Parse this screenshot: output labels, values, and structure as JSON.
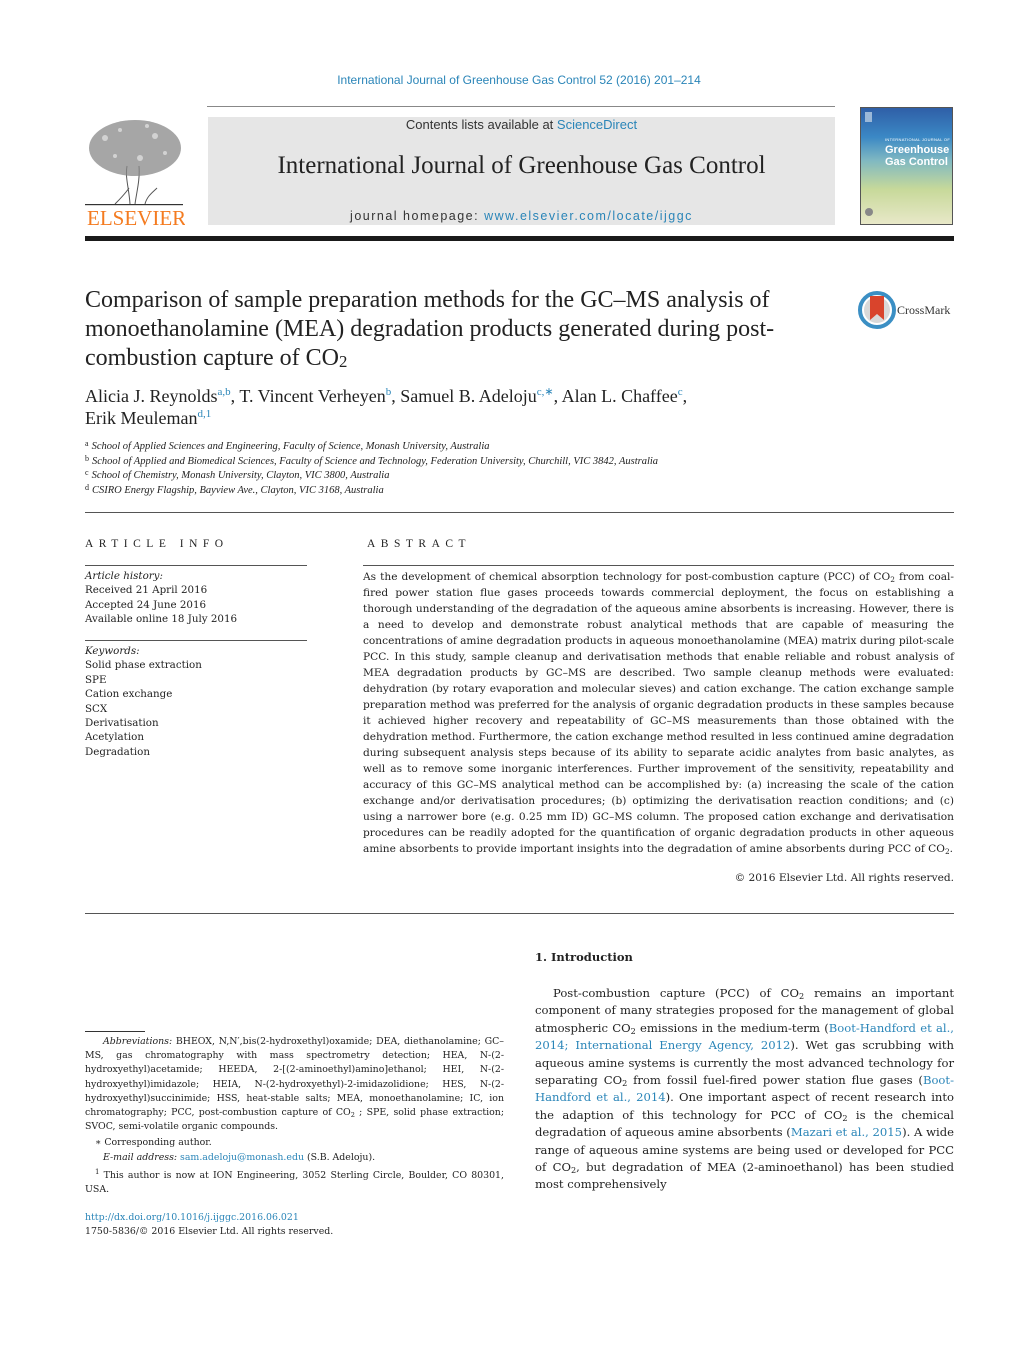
{
  "header": {
    "journal_citation": "International Journal of Greenhouse Gas Control 52 (2016) 201–214",
    "contents_prefix": "Contents lists available at ",
    "contents_link": "ScienceDirect",
    "journal_name": "International Journal of Greenhouse Gas Control",
    "homepage_prefix": "journal homepage: ",
    "homepage_link": "www.elsevier.com/locate/ijggc",
    "publisher_logo_text": "ELSEVIER",
    "cover_small_text": "INTERNATIONAL JOURNAL OF",
    "cover_title_line1": "Greenhouse",
    "cover_title_line2": "Gas Control"
  },
  "article": {
    "title_main": "Comparison of sample preparation methods for the GC–MS analysis of monoethanolamine (MEA) degradation products generated during post-combustion capture of CO",
    "title_sub": "2",
    "crossmark_label": "CrossMark",
    "authors": [
      {
        "name": "Alicia J. Reynolds",
        "sup": "a,b",
        "sep": ", "
      },
      {
        "name": "T. Vincent Verheyen",
        "sup": "b",
        "sep": ", "
      },
      {
        "name": "Samuel B. Adeloju",
        "sup": "c,∗",
        "sep": ", "
      },
      {
        "name": "Alan L. Chaffee",
        "sup": "c",
        "sep": ","
      },
      {
        "name": "Erik Meuleman",
        "sup": "d,1",
        "sep": ""
      }
    ],
    "affiliations": [
      {
        "key": "a",
        "text": "School of Applied Sciences and Engineering, Faculty of Science, Monash University, Australia"
      },
      {
        "key": "b",
        "text": "School of Applied and Biomedical Sciences, Faculty of Science and Technology, Federation University, Churchill, VIC 3842, Australia"
      },
      {
        "key": "c",
        "text": "School of Chemistry, Monash University, Clayton, VIC 3800, Australia"
      },
      {
        "key": "d",
        "text": "CSIRO Energy Flagship, Bayview Ave., Clayton, VIC 3168, Australia"
      }
    ]
  },
  "article_info": {
    "heading": "ARTICLE INFO",
    "history_label": "Article history:",
    "history": [
      "Received 21 April 2016",
      "Accepted 24 June 2016",
      "Available online 18 July 2016"
    ],
    "keywords_label": "Keywords:",
    "keywords": [
      "Solid phase extraction",
      "SPE",
      "Cation exchange",
      "SCX",
      "Derivatisation",
      "Acetylation",
      "Degradation"
    ]
  },
  "abstract": {
    "heading": "ABSTRACT",
    "part1": "As the development of chemical absorption technology for post-combustion capture (PCC) of CO",
    "part2": " from coal-fired power station flue gases proceeds towards commercial deployment, the focus on establishing a thorough understanding of the degradation of the aqueous amine absorbents is increasing. However, there is a need to develop and demonstrate robust analytical methods that are capable of measuring the concentrations of amine degradation products in aqueous monoethanolamine (MEA) matrix during pilot-scale PCC. In this study, sample cleanup and derivatisation methods that enable reliable and robust analysis of MEA degradation products by GC–MS are described. Two sample cleanup methods were evaluated: dehydration (by rotary evaporation and molecular sieves) and cation exchange. The cation exchange sample preparation method was preferred for the analysis of organic degradation products in these samples because it achieved higher recovery and repeatability of GC–MS measurements than those obtained with the dehydration method. Furthermore, the cation exchange method resulted in less continued amine degradation during subsequent analysis steps because of its ability to separate acidic analytes from basic analytes, as well as to remove some inorganic interferences. Further improvement of the sensitivity, repeatability and accuracy of this GC–MS analytical method can be accomplished by: (a) increasing the scale of the cation exchange and/or derivatisation procedures; (b) optimizing the derivatisation reaction conditions; and (c) using a narrower bore (e.g. 0.25 mm ID) GC–MS column. The proposed cation exchange and derivatisation procedures can be readily adopted for the quantification of organic degradation products in other aqueous amine absorbents to provide important insights into the degradation of amine absorbents during PCC of CO",
    "part3": ".",
    "sub": "2",
    "copyright": "© 2016 Elsevier Ltd. All rights reserved."
  },
  "introduction": {
    "heading": "1.  Introduction",
    "t1": "Post-combustion capture (PCC) of CO",
    "t2": " remains an important component of many strategies proposed for the management of global atmospheric CO",
    "t3": " emissions in the medium-term (",
    "ref1": "Boot-Handford et al., 2014; International Energy Agency, 2012",
    "t4": "). Wet gas scrubbing with aqueous amine systems is currently the most advanced technology for separating CO",
    "t5": " from fossil fuel-fired power station flue gases (",
    "ref2": "Boot-Handford et al., 2014",
    "t6": "). One important aspect of recent research into the adaption of this technology for PCC of CO",
    "t7": " is the chemical degradation of aqueous amine absorbents (",
    "ref3": "Mazari et al., 2015",
    "t8": "). A wide range of aqueous amine systems are being used or developed for PCC of CO",
    "t9": ", but degradation of MEA (2-aminoethanol) has been studied most comprehensively",
    "sub": "2"
  },
  "footnotes": {
    "abbrev_label": "Abbreviations:",
    "abbrev_text": " BHEOX, N,N′,bis(2-hydroxethyl)oxamide; DEA, diethanolamine; GC–MS, gas chromatography with mass spectrometry detection; HEA, N-(2-hydroxyethyl)acetamide; HEEDA, 2-[(2-aminoethyl)amino]ethanol; HEI, N-(2-hydroxyethyl)imidazole; HEIA, N-(2-hydroxyethyl)-2-imidazolidione; HES, N-(2-hydroxyethyl)succinimide; HSS, heat-stable salts; MEA, monoethanolamine; IC, ion chromatography; PCC, post-combustion capture of CO",
    "abbrev_text2": " ; SPE, solid phase extraction; SVOC, semi-volatile organic compounds.",
    "corresponding": "∗  Corresponding author.",
    "email_label": "E-mail address: ",
    "email": "sam.adeloju@monash.edu",
    "email_suffix": " (S.B. Adeloju).",
    "note1_mark": "1",
    "note1": " This author is now at ION Engineering, 3052 Sterling Circle, Boulder, CO 80301, USA.",
    "doi_link": "http://dx.doi.org/10.1016/j.ijggc.2016.06.021",
    "issn": "1750-5836/© 2016 Elsevier Ltd. All rights reserved.",
    "sub": "2"
  }
}
